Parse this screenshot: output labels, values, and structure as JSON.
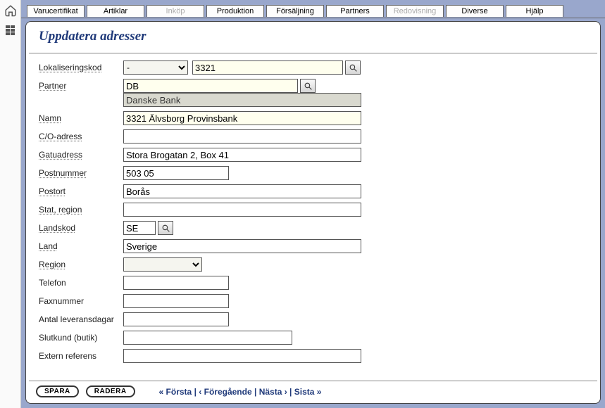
{
  "tabs": [
    {
      "label": "Varucertifikat",
      "disabled": false
    },
    {
      "label": "Artiklar",
      "disabled": false
    },
    {
      "label": "Inköp",
      "disabled": true
    },
    {
      "label": "Produktion",
      "disabled": false
    },
    {
      "label": "Försäljning",
      "disabled": false
    },
    {
      "label": "Partners",
      "disabled": false
    },
    {
      "label": "Redovisning",
      "disabled": true
    },
    {
      "label": "Diverse",
      "disabled": false
    },
    {
      "label": "Hjälp",
      "disabled": false
    }
  ],
  "title": "Uppdatera adresser",
  "labels": {
    "lokaliseringskod": "Lokaliseringskod",
    "partner": "Partner",
    "namn": "Namn",
    "co": "C/O-adress",
    "gatuadress": "Gatuadress",
    "postnummer": "Postnummer",
    "postort": "Postort",
    "stat": "Stat, region",
    "landskod": "Landskod",
    "land": "Land",
    "region": "Region",
    "telefon": "Telefon",
    "fax": "Faxnummer",
    "levdagar": "Antal leveransdagar",
    "slutkund": "Slutkund (butik)",
    "extern": "Extern referens"
  },
  "values": {
    "lokaliseringskod_select": "-",
    "lokaliseringskod": "3321",
    "partner": "DB",
    "partner_display": "Danske Bank",
    "namn": "3321 Älvsborg Provinsbank",
    "co": "",
    "gatuadress": "Stora Brogatan 2, Box 41",
    "postnummer": "503 05",
    "postort": "Borås",
    "stat": "",
    "landskod": "SE",
    "land": "Sverige",
    "region": "",
    "telefon": "",
    "fax": "",
    "levdagar": "",
    "slutkund": "",
    "extern": ""
  },
  "footer": {
    "save": "SPARA",
    "delete": "RADERA",
    "first": "« Första",
    "prev": "‹ Föregående",
    "next": "Nästa ›",
    "last": "Sista »"
  }
}
